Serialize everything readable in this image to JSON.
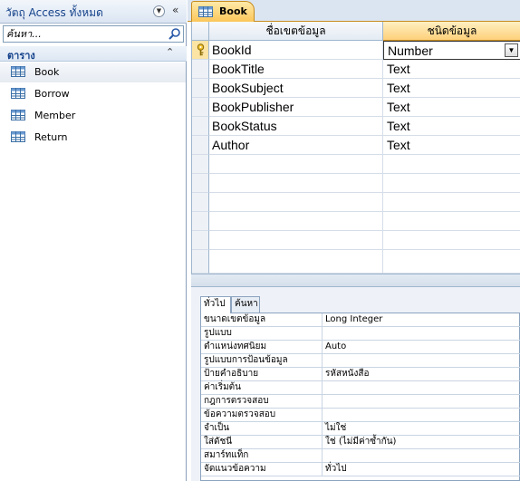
{
  "nav": {
    "title": "วัตถุ Access ทั้งหมด",
    "search_placeholder": "ค้นหา...",
    "group_label": "ตาราง",
    "items": [
      {
        "label": "Book"
      },
      {
        "label": "Borrow"
      },
      {
        "label": "Member"
      },
      {
        "label": "Return"
      }
    ]
  },
  "tab": {
    "label": "Book"
  },
  "grid": {
    "header_fieldname": "ชื่อเขตข้อมูล",
    "header_datatype": "ชนิดข้อมูล",
    "rows": [
      {
        "name": "BookId",
        "type": "Number",
        "primary_key": true
      },
      {
        "name": "BookTitle",
        "type": "Text"
      },
      {
        "name": "BookSubject",
        "type": "Text"
      },
      {
        "name": "BookPublisher",
        "type": "Text"
      },
      {
        "name": "BookStatus",
        "type": "Text"
      },
      {
        "name": "Author",
        "type": "Text"
      }
    ]
  },
  "props": {
    "tabs": [
      {
        "label": "ทั่วไป"
      },
      {
        "label": "ค้นหา"
      }
    ],
    "rows": [
      {
        "label": "ขนาดเขตข้อมูล",
        "value": "Long Integer"
      },
      {
        "label": "รูปแบบ",
        "value": ""
      },
      {
        "label": "ตำแหน่งทศนิยม",
        "value": "Auto"
      },
      {
        "label": "รูปแบบการป้อนข้อมูล",
        "value": ""
      },
      {
        "label": "ป้ายคำอธิบาย",
        "value": "รหัสหนังสือ"
      },
      {
        "label": "ค่าเริ่มต้น",
        "value": ""
      },
      {
        "label": "กฎการตรวจสอบ",
        "value": ""
      },
      {
        "label": "ข้อความตรวจสอบ",
        "value": ""
      },
      {
        "label": "จำเป็น",
        "value": "ไม่ใช่"
      },
      {
        "label": "ใส่ดัชนี",
        "value": "ใช่ (ไม่มีค่าซ้ำกัน)"
      },
      {
        "label": "สมาร์ทแท็ก",
        "value": ""
      },
      {
        "label": "จัดแนวข้อความ",
        "value": "ทั่วไป"
      }
    ]
  },
  "colors": {
    "accent": "#fbc75a",
    "nav_text": "#15428b"
  }
}
